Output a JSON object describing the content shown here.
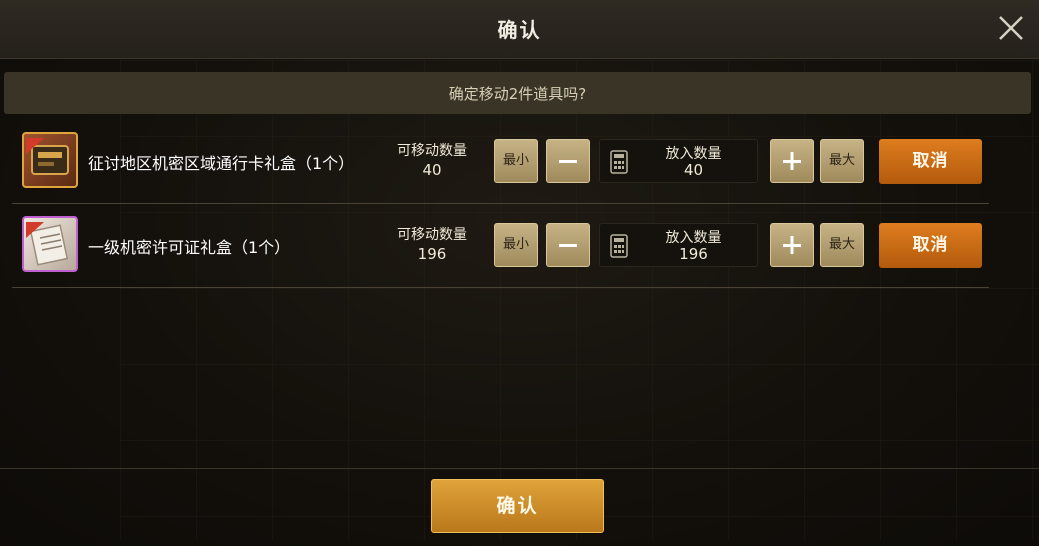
{
  "dialog": {
    "title": "确认",
    "message": "确定移动2件道具吗?",
    "confirm_label": "确认"
  },
  "labels": {
    "movable_qty": "可移动数量",
    "put_qty": "放入数量",
    "min": "最小",
    "max": "最大",
    "cancel": "取消"
  },
  "items": [
    {
      "name": "征讨地区机密区域通行卡礼盒（1个）",
      "movable": "40",
      "put": "40",
      "icon": "pass-card-giftbox-icon",
      "rarity_color": "#e0a53a"
    },
    {
      "name": "一级机密许可证礼盒（1个）",
      "movable": "196",
      "put": "196",
      "icon": "secret-permit-giftbox-icon",
      "rarity_color": "#c060d0"
    }
  ],
  "colors": {
    "accent_orange": "#c96a14",
    "confirm_gold": "#cf8d28",
    "control_tan": "#b39f72"
  }
}
